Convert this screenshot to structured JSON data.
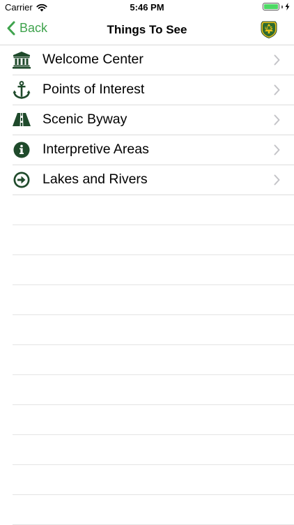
{
  "status_bar": {
    "carrier": "Carrier",
    "time": "5:46 PM",
    "battery_level": 1.0
  },
  "nav": {
    "back_label": "Back",
    "title": "Things To See",
    "logo_icon": "usfs-shield-icon"
  },
  "colors": {
    "accent": "#3fa34d",
    "icon_green": "#1f4a2b",
    "separator": "#dcdcdc"
  },
  "list": {
    "items": [
      {
        "label": "Welcome Center",
        "icon": "building-icon"
      },
      {
        "label": "Points of Interest",
        "icon": "anchor-icon"
      },
      {
        "label": "Scenic Byway",
        "icon": "road-icon"
      },
      {
        "label": "Interpretive Areas",
        "icon": "info-circle-icon"
      },
      {
        "label": "Lakes and Rivers",
        "icon": "arrow-circle-right-icon"
      }
    ]
  }
}
